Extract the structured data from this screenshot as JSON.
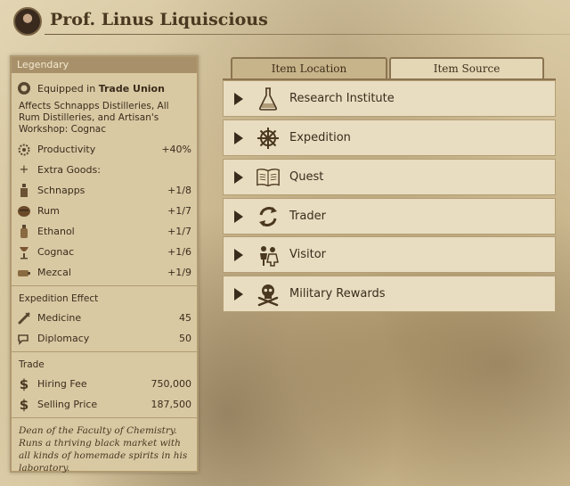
{
  "header": {
    "title": "Prof. Linus Liquiscious",
    "avatar_icon": "professor-portrait-icon"
  },
  "panel": {
    "title": "Legendary",
    "equipped_prefix": "Equipped in",
    "equipped_in": "Trade Union",
    "affects": "Affects Schnapps Distilleries, All Rum Distilleries, and Artisan's Workshop: Cognac",
    "productivity": {
      "label": "Productivity",
      "value": "+40%"
    },
    "extra_goods_label": "Extra Goods:",
    "goods": [
      {
        "icon": "schnapps-icon",
        "label": "Schnapps",
        "value": "+1/8"
      },
      {
        "icon": "rum-icon",
        "label": "Rum",
        "value": "+1/7"
      },
      {
        "icon": "ethanol-icon",
        "label": "Ethanol",
        "value": "+1/7"
      },
      {
        "icon": "cognac-icon",
        "label": "Cognac",
        "value": "+1/6"
      },
      {
        "icon": "mezcal-icon",
        "label": "Mezcal",
        "value": "+1/9"
      }
    ],
    "expedition_title": "Expedition Effect",
    "expedition": [
      {
        "icon": "medicine-icon",
        "label": "Medicine",
        "value": "45"
      },
      {
        "icon": "diplomacy-icon",
        "label": "Diplomacy",
        "value": "50"
      }
    ],
    "trade_title": "Trade",
    "trade": [
      {
        "icon": "coin-icon",
        "label": "Hiring Fee",
        "value": "750,000"
      },
      {
        "icon": "coin-icon",
        "label": "Selling Price",
        "value": "187,500"
      }
    ],
    "flavor": "Dean of the Faculty of Chemistry. Runs a thriving black market with all kinds of homemade spirits in his laboratory."
  },
  "tabs": [
    {
      "label": "Item Location",
      "active": false
    },
    {
      "label": "Item Source",
      "active": true
    }
  ],
  "sources": [
    {
      "icon": "flask-icon",
      "label": "Research Institute"
    },
    {
      "icon": "ship-wheel-icon",
      "label": "Expedition"
    },
    {
      "icon": "book-icon",
      "label": "Quest"
    },
    {
      "icon": "trade-arrows-icon",
      "label": "Trader"
    },
    {
      "icon": "visitor-icon",
      "label": "Visitor"
    },
    {
      "icon": "skull-crossbones-icon",
      "label": "Military Rewards"
    }
  ],
  "colors": {
    "panel_header": "#a8916a",
    "panel_bg": "#d9c9a3",
    "source_bg": "#e8ddc1",
    "text": "#3a2c1c"
  }
}
